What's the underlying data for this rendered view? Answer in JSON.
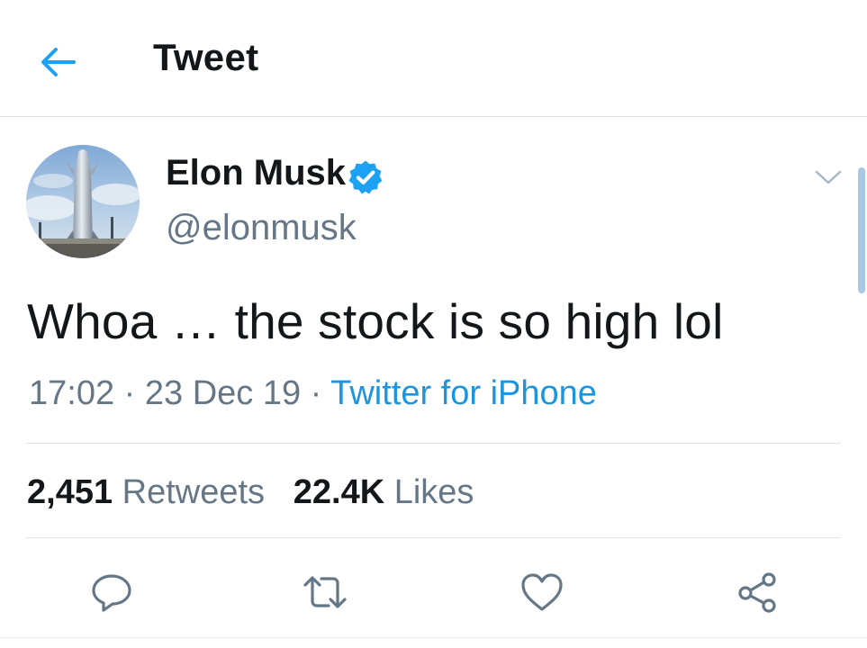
{
  "header": {
    "title": "Tweet",
    "back_icon": "arrow-left-icon",
    "accent_color": "#1da1f2"
  },
  "tweet": {
    "author": {
      "display_name": "Elon Musk",
      "handle": "@elonmusk",
      "verified": true,
      "verified_icon": "verified-badge-icon"
    },
    "text": "Whoa … the stock is so high lol",
    "time": "17:02",
    "date": "23 Dec 19",
    "separator": "·",
    "source": "Twitter for iPhone",
    "stats": {
      "retweets_count": "2,451",
      "retweets_label": "Retweets",
      "likes_count": "22.4K",
      "likes_label": "Likes"
    },
    "actions": [
      "reply-icon",
      "retweet-icon",
      "like-icon",
      "share-icon"
    ]
  },
  "colors": {
    "text_primary": "#14171a",
    "text_secondary": "#657786",
    "link": "#1b95e0",
    "divider": "#dfe3e6",
    "verified": "#1da1f2"
  }
}
